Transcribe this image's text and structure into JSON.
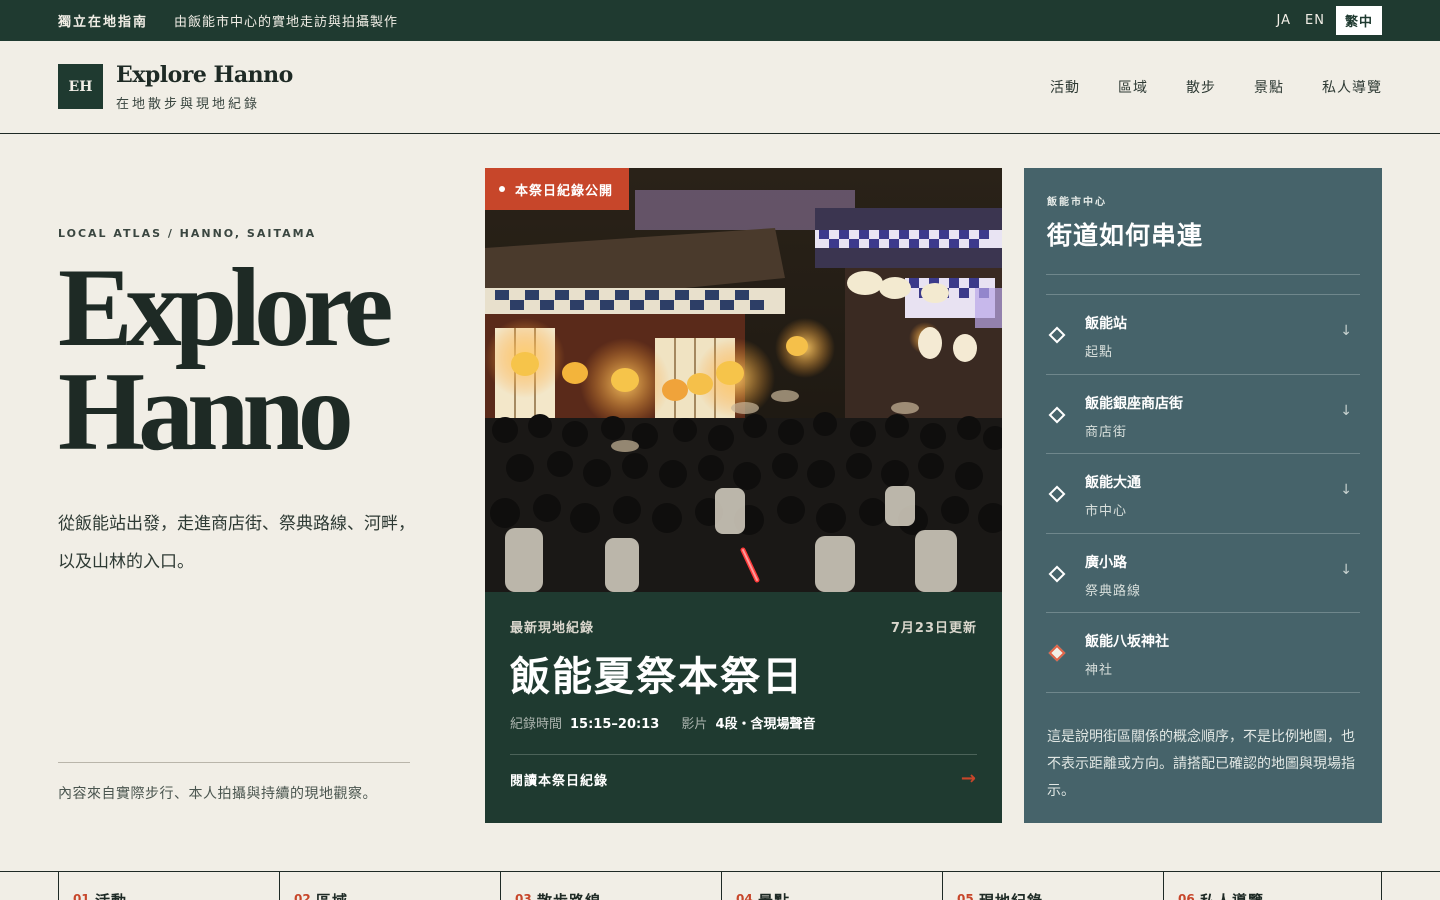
{
  "topbar": {
    "brand": "獨立在地指南",
    "tagline": "由飯能市中心的實地走訪與拍攝製作",
    "languages": [
      "JA",
      "EN",
      "繁中"
    ],
    "active_language": "繁中"
  },
  "header": {
    "logo_mark": "EH",
    "title": "Explore Hanno",
    "subtitle": "在地散步與現地紀錄",
    "nav": [
      "活動",
      "區域",
      "散步",
      "景點",
      "私人導覽"
    ]
  },
  "hero": {
    "kicker": "LOCAL ATLAS / HANNO, SAITAMA",
    "title_line1": "Explore",
    "title_line2": "Hanno",
    "description": "從飯能站出發，走進商店街、祭典路線、河畔，以及山林的入口。",
    "note": "內容來自實際步行、本人拍攝與持續的現地觀察。"
  },
  "feature": {
    "badge": "本祭日紀錄公開",
    "label": "最新現地紀錄",
    "updated": "7月23日更新",
    "title": "飯能夏祭本祭日",
    "meta_time_label": "紀錄時間",
    "meta_time_value": "15:15–20:13",
    "meta_video_label": "影片",
    "meta_video_value": "4段・含現場聲音",
    "link_label": "閱讀本祭日紀錄",
    "link_arrow": "→"
  },
  "panel": {
    "kicker": "飯能市中心",
    "title": "街道如何串連",
    "stops": [
      {
        "name": "飯能站",
        "sub": "起點",
        "arrow": "↓"
      },
      {
        "name": "飯能銀座商店街",
        "sub": "商店街",
        "arrow": "↓"
      },
      {
        "name": "飯能大通",
        "sub": "市中心",
        "arrow": "↓"
      },
      {
        "name": "廣小路",
        "sub": "祭典路線",
        "arrow": "↓"
      },
      {
        "name": "飯能八坂神社",
        "sub": "神社",
        "arrow": ""
      }
    ],
    "note": "這是說明街區關係的概念順序，不是比例地圖，也不表示距離或方向。請搭配已確認的地圖與現場指示。"
  },
  "bottom_nav": [
    {
      "num": "01",
      "label": "活動"
    },
    {
      "num": "02",
      "label": "區域"
    },
    {
      "num": "03",
      "label": "散步路線"
    },
    {
      "num": "04",
      "label": "景點"
    },
    {
      "num": "05",
      "label": "現地紀錄"
    },
    {
      "num": "06",
      "label": "私人導覽"
    }
  ],
  "colors": {
    "dark_green": "#1f3a30",
    "accent_red": "#c7462a",
    "panel_slate": "#46636a",
    "paper": "#f1eee6"
  }
}
